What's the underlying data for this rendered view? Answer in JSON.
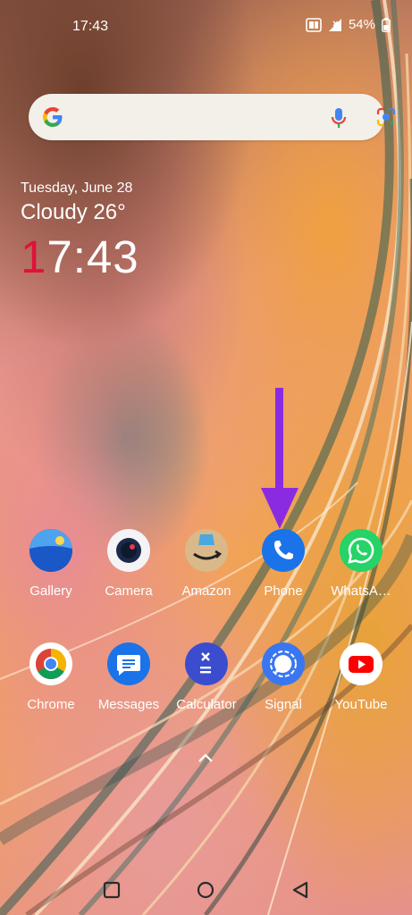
{
  "status_bar": {
    "time": "17:43",
    "battery_percent": "54%",
    "icons": [
      "hd-volte-icon",
      "signal-icon",
      "battery-icon"
    ]
  },
  "search_bar": {
    "icons": [
      "google-g-icon",
      "microphone-icon",
      "google-lens-icon"
    ]
  },
  "widget": {
    "date": "Tuesday, June 28",
    "weather": "Cloudy 26°",
    "clock_first_digit": "1",
    "clock_rest": "7:43"
  },
  "apps_row1": [
    {
      "label": "Gallery",
      "icon": "gallery-icon"
    },
    {
      "label": "Camera",
      "icon": "camera-icon"
    },
    {
      "label": "Amazon",
      "icon": "amazon-icon"
    },
    {
      "label": "Phone",
      "icon": "phone-icon"
    },
    {
      "label": "WhatsA…",
      "icon": "whatsapp-icon"
    }
  ],
  "apps_row2": [
    {
      "label": "Chrome",
      "icon": "chrome-icon"
    },
    {
      "label": "Messages",
      "icon": "messages-icon"
    },
    {
      "label": "Calculator",
      "icon": "calculator-icon"
    },
    {
      "label": "Signal",
      "icon": "signal-app-icon"
    },
    {
      "label": "YouTube",
      "icon": "youtube-icon"
    }
  ],
  "annotation": {
    "color": "#8a2be2",
    "target": "Phone"
  },
  "nav": {
    "icons": [
      "recents-icon",
      "home-icon",
      "back-icon"
    ]
  },
  "colors": {
    "search_bg": "#f3efe9",
    "clock_accent": "#e0113a",
    "phone_blue": "#1a73e8",
    "whatsapp_green": "#25d366",
    "youtube_red": "#ff0000",
    "signal_blue": "#3a76f0",
    "calculator_indigo": "#3c4ccf"
  }
}
